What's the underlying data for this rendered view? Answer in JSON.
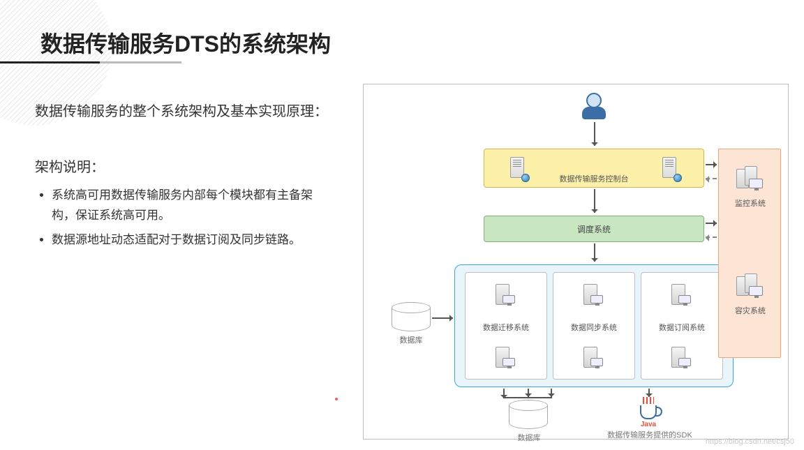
{
  "title": "数据传输服务DTS的系统架构",
  "intro": "数据传输服务的整个系统架构及基本实现原理：",
  "sub_heading": "架构说明：",
  "bullets": [
    "系统高可用数据传输服务内部每个模块都有主备架构，保证系统高可用。",
    "数据源地址动态适配对于数据订阅及同步链路。"
  ],
  "diagram": {
    "user_icon": "user-icon",
    "control_panel": "数据传输服务控制台",
    "scheduler": "调度系统",
    "systems": [
      "数据迁移系统",
      "数据同步系统",
      "数据订阅系统"
    ],
    "right": [
      "监控系统",
      "容灾系统"
    ],
    "db_left": "数据库",
    "db_bottom": "数据库",
    "sdk": "数据传输服务提供的SDK",
    "java": "Java"
  },
  "watermark": "https://blog.csdn.net/csj50"
}
